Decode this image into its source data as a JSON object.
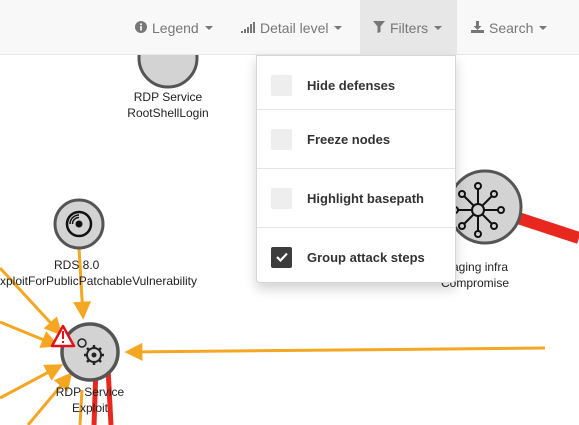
{
  "navbar": {
    "legend": {
      "label": "Legend"
    },
    "detail_level": {
      "label": "Detail level"
    },
    "filters": {
      "label": "Filters"
    },
    "search": {
      "label": "Search"
    }
  },
  "filters_menu": {
    "items": [
      {
        "label": "Hide defenses",
        "checked": false
      },
      {
        "label": "Freeze nodes",
        "checked": false
      },
      {
        "label": "Highlight basepath",
        "checked": false
      },
      {
        "label": "Group attack steps",
        "checked": true
      }
    ]
  },
  "graph": {
    "nodes": {
      "rdp_rootshell": {
        "line1": "RDP Service",
        "line2": "RootShellLogin",
        "icon": "node-circle"
      },
      "rds": {
        "line1": "RDS 8.0",
        "line2": "xploitForPublicPatchableVulnerability",
        "icon": "disk-icon"
      },
      "rdp_exploit": {
        "line1": "RDP Service",
        "line2": "Exploit",
        "icon": "gears-icon",
        "badge": "warning-icon"
      },
      "staging": {
        "line1": "aging infra",
        "line2": "Compromise",
        "icon": "network-hub-icon"
      }
    }
  },
  "colors": {
    "edge_orange": "#f5a623",
    "edge_red": "#e8281e",
    "navbar_bg": "#f8f8f8",
    "navbar_text": "#777777",
    "checkbox_on": "#3d3d3d",
    "checkbox_off": "#eeeeee"
  }
}
